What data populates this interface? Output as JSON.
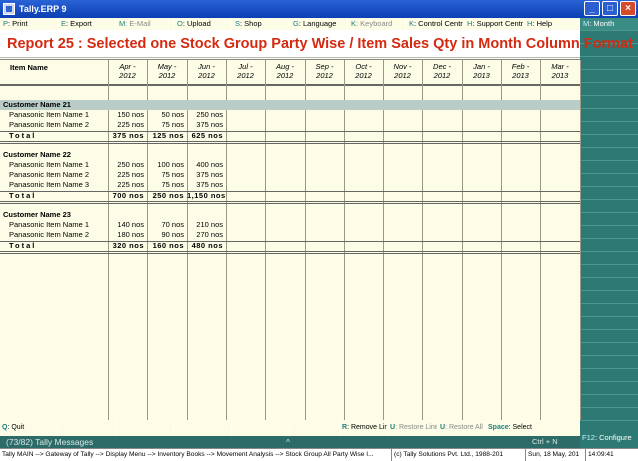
{
  "window": {
    "title": "Tally.ERP 9",
    "min": "_",
    "max": "□",
    "close": "×"
  },
  "menu": [
    {
      "key": "P",
      "label": ": Print",
      "disabled": false
    },
    {
      "key": "E",
      "label": ": Export",
      "disabled": false
    },
    {
      "key": "M",
      "label": ": E-Mail",
      "disabled": true
    },
    {
      "key": "O",
      "label": ": Upload",
      "disabled": false
    },
    {
      "key": "S",
      "label": ": Shop",
      "disabled": false
    },
    {
      "key": "G",
      "label": ": Language",
      "disabled": false
    },
    {
      "key": "K",
      "label": ": Keyboard",
      "disabled": true
    },
    {
      "key": "K",
      "label": ": Control Centre",
      "disabled": false
    },
    {
      "key": "H",
      "label": ": Support Centre",
      "disabled": false
    },
    {
      "key": "H",
      "label": ": Help",
      "disabled": false
    }
  ],
  "right_panel": {
    "month_key": "M",
    "month_label": ": Month",
    "configure_key": "F12",
    "configure_label": ": Configure"
  },
  "report_title": "Report 25 : Selected one Stock Group Party Wise / Item Sales Qty in Month Column Format",
  "table": {
    "name_header": "Item Name",
    "months": [
      {
        "m": "Apr -",
        "y": "2012"
      },
      {
        "m": "May -",
        "y": "2012"
      },
      {
        "m": "Jun -",
        "y": "2012"
      },
      {
        "m": "Jul -",
        "y": "2012"
      },
      {
        "m": "Aug -",
        "y": "2012"
      },
      {
        "m": "Sep -",
        "y": "2012"
      },
      {
        "m": "Oct -",
        "y": "2012"
      },
      {
        "m": "Nov -",
        "y": "2012"
      },
      {
        "m": "Dec -",
        "y": "2012"
      },
      {
        "m": "Jan -",
        "y": "2013"
      },
      {
        "m": "Feb -",
        "y": "2013"
      },
      {
        "m": "Mar -",
        "y": "2013"
      }
    ],
    "groups": [
      {
        "customer": "Customer Name 21",
        "items": [
          {
            "name": "Panasonic Item Name 1",
            "values": [
              "150 nos",
              "50 nos",
              "250 nos"
            ]
          },
          {
            "name": "Panasonic Item Name 2",
            "values": [
              "225 nos",
              "75 nos",
              "375 nos"
            ]
          }
        ],
        "total_label": "Total",
        "total": [
          "375 nos",
          "125 nos",
          "625 nos"
        ]
      },
      {
        "customer": "Customer Name 22",
        "items": [
          {
            "name": "Panasonic Item Name 1",
            "values": [
              "250 nos",
              "100 nos",
              "400 nos"
            ]
          },
          {
            "name": "Panasonic Item Name 2",
            "values": [
              "225 nos",
              "75 nos",
              "375 nos"
            ]
          },
          {
            "name": "Panasonic Item Name 3",
            "values": [
              "225 nos",
              "75 nos",
              "375 nos"
            ]
          }
        ],
        "total_label": "Total",
        "total": [
          "700 nos",
          "250 nos",
          "1,150 nos"
        ]
      },
      {
        "customer": "Customer Name 23",
        "items": [
          {
            "name": "Panasonic Item Name 1",
            "values": [
              "140 nos",
              "70 nos",
              "210 nos"
            ]
          },
          {
            "name": "Panasonic Item Name 2",
            "values": [
              "180 nos",
              "90 nos",
              "270 nos"
            ]
          }
        ],
        "total_label": "Total",
        "total": [
          "320 nos",
          "160 nos",
          "480 nos"
        ]
      }
    ]
  },
  "bottom_bar": [
    {
      "key": "Q",
      "label": ": Quit",
      "disabled": false
    },
    {
      "key": "",
      "label": "",
      "disabled": false
    },
    {
      "key": "",
      "label": "",
      "disabled": false
    },
    {
      "key": "",
      "label": "",
      "disabled": false
    },
    {
      "key": "",
      "label": "",
      "disabled": false
    },
    {
      "key": "",
      "label": "",
      "disabled": false
    },
    {
      "key": "R",
      "label": ": Remove Line",
      "disabled": false
    },
    {
      "key": "U",
      "label": ": Restore Line",
      "disabled": true
    },
    {
      "key": "U",
      "label": ": Restore All",
      "disabled": true
    },
    {
      "key": "Space",
      "label": ": Select",
      "disabled": false
    }
  ],
  "messages": {
    "text": "(73/82) Tally Messages",
    "arrow": "^",
    "ctrl": "Ctrl + N"
  },
  "status": {
    "path": "Tally MAIN --> Gateway of Tally --> Display Menu --> Inventory Books --> Movement Analysis --> Stock Group All Party Wise I...",
    "copyright": "(c) Tally Solutions Pvt. Ltd., 1988-201",
    "date": "Sun, 18 May, 201",
    "time": "14:09:41"
  }
}
